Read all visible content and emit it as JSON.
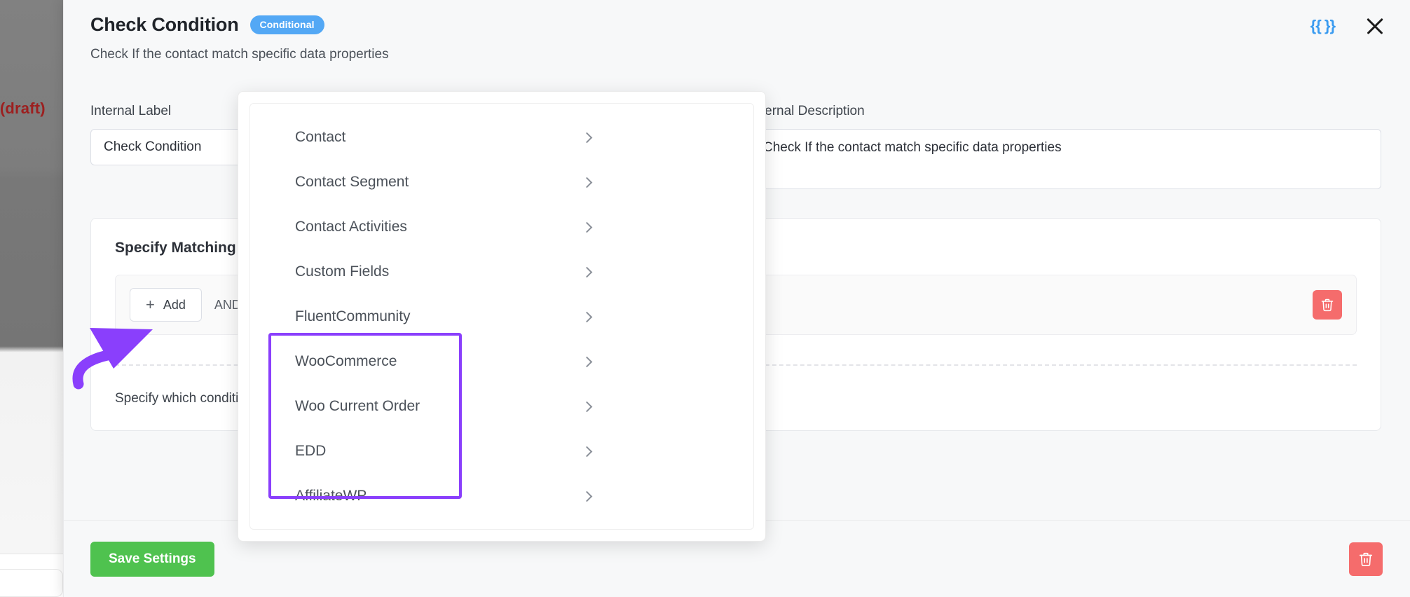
{
  "background": {
    "draft_text": ") (draft)"
  },
  "modal": {
    "header": {
      "title": "Check Condition",
      "badge": "Conditional",
      "subtitle": "Check If the contact match specific data properties",
      "smartcode_icon_label": "{{ }}",
      "close_icon_name": "close-icon"
    },
    "fields": {
      "internal_label": {
        "label": "Internal Label",
        "value": "Check Condition",
        "placeholder": "Internal Label"
      },
      "internal_description": {
        "label": "Internal Description",
        "value": "Check If the contact match specific data properties",
        "placeholder": "Internal Description"
      }
    },
    "match_card": {
      "title": "Specify Matching Conditions",
      "add_button": "Add",
      "add_icon": "plus-icon",
      "and_label": "AND",
      "delete_icon": "trash-icon",
      "helper_text": "Specify which condition blocks should match. You can add multiple blocks or no blocks"
    },
    "footer": {
      "save_label": "Save Settings",
      "delete_icon": "trash-icon"
    }
  },
  "dropdown": {
    "items": [
      {
        "label": "Contact",
        "icon": "chevron-right-icon",
        "highlighted": false
      },
      {
        "label": "Contact Segment",
        "icon": "chevron-right-icon",
        "highlighted": false
      },
      {
        "label": "Contact Activities",
        "icon": "chevron-right-icon",
        "highlighted": false
      },
      {
        "label": "Custom Fields",
        "icon": "chevron-right-icon",
        "highlighted": false
      },
      {
        "label": "FluentCommunity",
        "icon": "chevron-right-icon",
        "highlighted": false
      },
      {
        "label": "WooCommerce",
        "icon": "chevron-right-icon",
        "highlighted": true
      },
      {
        "label": "Woo Current Order",
        "icon": "chevron-right-icon",
        "highlighted": true
      },
      {
        "label": "EDD",
        "icon": "chevron-right-icon",
        "highlighted": true
      },
      {
        "label": "AffiliateWP",
        "icon": "chevron-right-icon",
        "highlighted": true
      }
    ]
  },
  "annotations": {
    "highlight_color": "#8a3ffc",
    "arrow_color": "#8a3ffc",
    "arrow_target": "add-button"
  },
  "colors": {
    "badge_blue": "#53a8f5",
    "save_green": "#4fc24f",
    "delete_red": "#f56c6c",
    "smartcode_blue": "#3a9bf0",
    "draft_red": "#9c1f1f"
  }
}
